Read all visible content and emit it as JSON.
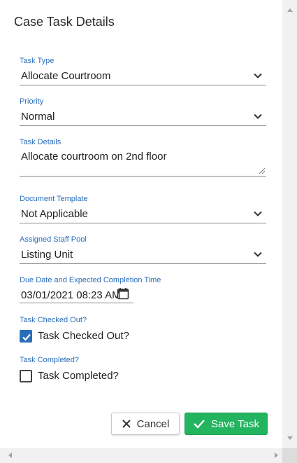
{
  "dialog": {
    "title": "Case Task Details"
  },
  "fields": {
    "task_type": {
      "label": "Task Type",
      "value": "Allocate Courtroom"
    },
    "priority": {
      "label": "Priority",
      "value": "Normal"
    },
    "task_details": {
      "label": "Task Details",
      "value": "Allocate courtroom on 2nd floor"
    },
    "document_template": {
      "label": "Document Template",
      "value": "Not Applicable"
    },
    "assigned_staff_pool": {
      "label": "Assigned Staff Pool",
      "value": "Listing Unit"
    },
    "due_date": {
      "label": "Due Date and Expected Completion Time",
      "value": "03/01/2021 08:23 AM"
    },
    "task_checked_out": {
      "label": "Task Checked Out?",
      "checkbox_label": "Task Checked Out?",
      "checked": true
    },
    "task_completed": {
      "label": "Task Completed?",
      "checkbox_label": "Task Completed?",
      "checked": false
    }
  },
  "buttons": {
    "cancel_label": "Cancel",
    "save_label": "Save Task"
  },
  "colors": {
    "accent": "#2a6ebb",
    "save": "#22b45e"
  }
}
